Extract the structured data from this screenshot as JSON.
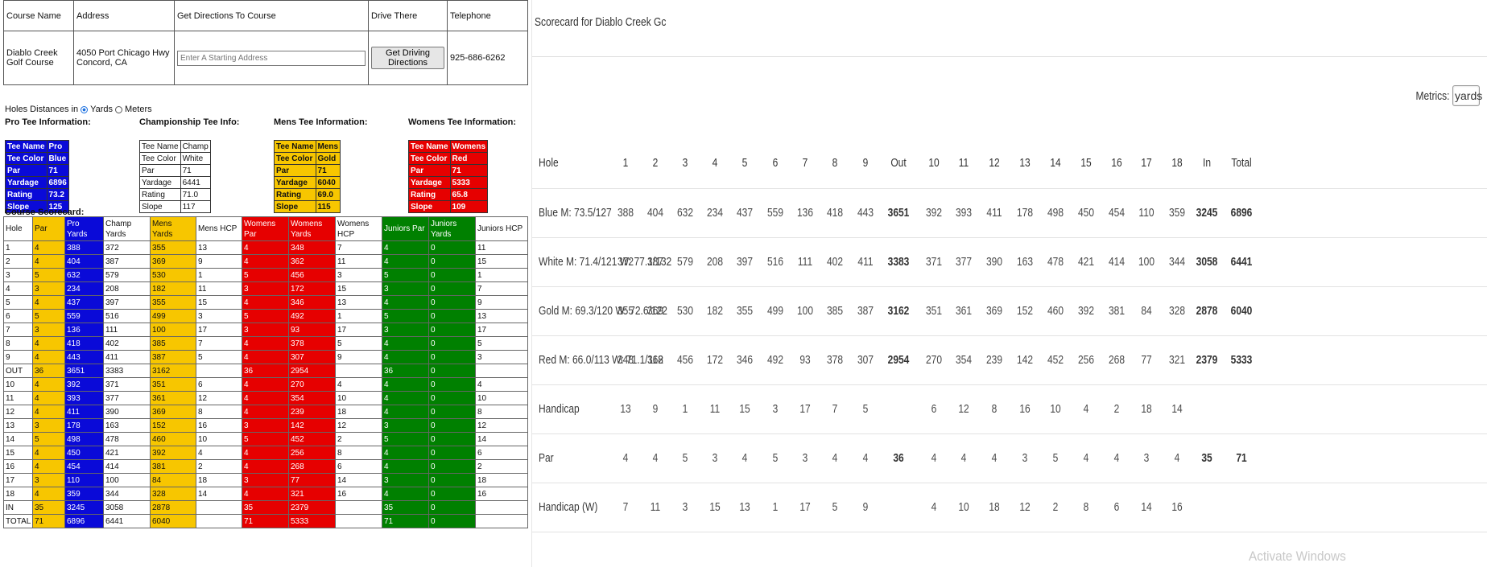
{
  "course_info": {
    "headers": [
      "Course Name",
      "Address",
      "Get Directions To Course",
      "Drive There",
      "Telephone"
    ],
    "course_name": "Diablo Creek Golf Course",
    "address_line1": "4050 Port Chicago Hwy",
    "address_line2": "Concord, CA",
    "directions_placeholder": "Enter A Starting Address",
    "directions_button": "Get Driving Directions",
    "telephone": "925-686-6262"
  },
  "units": {
    "label": "Holes Distances in",
    "yards": "Yards",
    "meters": "Meters",
    "selected": "yards"
  },
  "tee_headings": {
    "pro": "Pro Tee Information:",
    "champ": "Championship Tee Info:",
    "mens": "Mens Tee Information:",
    "womens": "Womens Tee Information:"
  },
  "tees": {
    "pro": [
      [
        "Tee Name",
        "Pro"
      ],
      [
        "Tee Color",
        "Blue"
      ],
      [
        "Par",
        "71"
      ],
      [
        "Yardage",
        "6896"
      ],
      [
        "Rating",
        "73.2"
      ],
      [
        "Slope",
        "125"
      ]
    ],
    "champ": [
      [
        "Tee Name",
        "Champ"
      ],
      [
        "Tee Color",
        "White"
      ],
      [
        "Par",
        "71"
      ],
      [
        "Yardage",
        "6441"
      ],
      [
        "Rating",
        "71.0"
      ],
      [
        "Slope",
        "117"
      ]
    ],
    "mens": [
      [
        "Tee Name",
        "Mens"
      ],
      [
        "Tee Color",
        "Gold"
      ],
      [
        "Par",
        "71"
      ],
      [
        "Yardage",
        "6040"
      ],
      [
        "Rating",
        "69.0"
      ],
      [
        "Slope",
        "115"
      ]
    ],
    "womens": [
      [
        "Tee Name",
        "Womens"
      ],
      [
        "Tee Color",
        "Red"
      ],
      [
        "Par",
        "71"
      ],
      [
        "Yardage",
        "5333"
      ],
      [
        "Rating",
        "65.8"
      ],
      [
        "Slope",
        "109"
      ]
    ]
  },
  "scorecard_title": "Course Scorecard:",
  "scorecard": {
    "headers": [
      "Hole",
      "Par",
      "Pro Yards",
      "Champ Yards",
      "Mens Yards",
      "Mens HCP",
      "Womens Par",
      "Womens Yards",
      "Womens HCP",
      "Juniors Par",
      "Juniors Yards",
      "Juniors HCP"
    ],
    "rows": [
      [
        "1",
        "4",
        "388",
        "372",
        "355",
        "13",
        "4",
        "348",
        "7",
        "4",
        "0",
        "11"
      ],
      [
        "2",
        "4",
        "404",
        "387",
        "369",
        "9",
        "4",
        "362",
        "11",
        "4",
        "0",
        "15"
      ],
      [
        "3",
        "5",
        "632",
        "579",
        "530",
        "1",
        "5",
        "456",
        "3",
        "5",
        "0",
        "1"
      ],
      [
        "4",
        "3",
        "234",
        "208",
        "182",
        "11",
        "3",
        "172",
        "15",
        "3",
        "0",
        "7"
      ],
      [
        "5",
        "4",
        "437",
        "397",
        "355",
        "15",
        "4",
        "346",
        "13",
        "4",
        "0",
        "9"
      ],
      [
        "6",
        "5",
        "559",
        "516",
        "499",
        "3",
        "5",
        "492",
        "1",
        "5",
        "0",
        "13"
      ],
      [
        "7",
        "3",
        "136",
        "111",
        "100",
        "17",
        "3",
        "93",
        "17",
        "3",
        "0",
        "17"
      ],
      [
        "8",
        "4",
        "418",
        "402",
        "385",
        "7",
        "4",
        "378",
        "5",
        "4",
        "0",
        "5"
      ],
      [
        "9",
        "4",
        "443",
        "411",
        "387",
        "5",
        "4",
        "307",
        "9",
        "4",
        "0",
        "3"
      ],
      [
        "OUT",
        "36",
        "3651",
        "3383",
        "3162",
        "",
        "36",
        "2954",
        "",
        "36",
        "0",
        ""
      ],
      [
        "10",
        "4",
        "392",
        "371",
        "351",
        "6",
        "4",
        "270",
        "4",
        "4",
        "0",
        "4"
      ],
      [
        "11",
        "4",
        "393",
        "377",
        "361",
        "12",
        "4",
        "354",
        "10",
        "4",
        "0",
        "10"
      ],
      [
        "12",
        "4",
        "411",
        "390",
        "369",
        "8",
        "4",
        "239",
        "18",
        "4",
        "0",
        "8"
      ],
      [
        "13",
        "3",
        "178",
        "163",
        "152",
        "16",
        "3",
        "142",
        "12",
        "3",
        "0",
        "12"
      ],
      [
        "14",
        "5",
        "498",
        "478",
        "460",
        "10",
        "5",
        "452",
        "2",
        "5",
        "0",
        "14"
      ],
      [
        "15",
        "4",
        "450",
        "421",
        "392",
        "4",
        "4",
        "256",
        "8",
        "4",
        "0",
        "6"
      ],
      [
        "16",
        "4",
        "454",
        "414",
        "381",
        "2",
        "4",
        "268",
        "6",
        "4",
        "0",
        "2"
      ],
      [
        "17",
        "3",
        "110",
        "100",
        "84",
        "18",
        "3",
        "77",
        "14",
        "3",
        "0",
        "18"
      ],
      [
        "18",
        "4",
        "359",
        "344",
        "328",
        "14",
        "4",
        "321",
        "16",
        "4",
        "0",
        "16"
      ],
      [
        "IN",
        "35",
        "3245",
        "3058",
        "2878",
        "",
        "35",
        "2379",
        "",
        "35",
        "0",
        ""
      ],
      [
        "TOTAL",
        "71",
        "6896",
        "6441",
        "6040",
        "",
        "71",
        "5333",
        "",
        "71",
        "0",
        ""
      ]
    ]
  },
  "right": {
    "title": "Scorecard for Diablo Creek Gc",
    "metrics_label": "Metrics:",
    "metrics_value": "yards",
    "columns": [
      "Hole",
      "1",
      "2",
      "3",
      "4",
      "5",
      "6",
      "7",
      "8",
      "9",
      "Out",
      "10",
      "11",
      "12",
      "13",
      "14",
      "15",
      "16",
      "17",
      "18",
      "In",
      "Total"
    ],
    "rows": [
      [
        "Blue M: 73.5/127",
        "388",
        "404",
        "632",
        "234",
        "437",
        "559",
        "136",
        "418",
        "443",
        "3651",
        "392",
        "393",
        "411",
        "178",
        "498",
        "450",
        "454",
        "110",
        "359",
        "3245",
        "6896"
      ],
      [
        "White M: 71.4/121 W: 77.1/132",
        "372",
        "387",
        "579",
        "208",
        "397",
        "516",
        "111",
        "402",
        "411",
        "3383",
        "371",
        "377",
        "390",
        "163",
        "478",
        "421",
        "414",
        "100",
        "344",
        "3058",
        "6441"
      ],
      [
        "Gold M: 69.3/120 W: 72.6/122",
        "355",
        "369",
        "530",
        "182",
        "355",
        "499",
        "100",
        "385",
        "387",
        "3162",
        "351",
        "361",
        "369",
        "152",
        "460",
        "392",
        "381",
        "84",
        "328",
        "2878",
        "6040"
      ],
      [
        "Red M: 66.0/113 W: 71.1/118",
        "348",
        "362",
        "456",
        "172",
        "346",
        "492",
        "93",
        "378",
        "307",
        "2954",
        "270",
        "354",
        "239",
        "142",
        "452",
        "256",
        "268",
        "77",
        "321",
        "2379",
        "5333"
      ],
      [
        "Handicap",
        "13",
        "9",
        "1",
        "11",
        "15",
        "3",
        "17",
        "7",
        "5",
        "",
        "6",
        "12",
        "8",
        "16",
        "10",
        "4",
        "2",
        "18",
        "14",
        "",
        ""
      ],
      [
        "Par",
        "4",
        "4",
        "5",
        "3",
        "4",
        "5",
        "3",
        "4",
        "4",
        "36",
        "4",
        "4",
        "4",
        "3",
        "5",
        "4",
        "4",
        "3",
        "4",
        "35",
        "71"
      ],
      [
        "Handicap (W)",
        "7",
        "11",
        "3",
        "15",
        "13",
        "1",
        "17",
        "5",
        "9",
        "",
        "4",
        "10",
        "18",
        "12",
        "2",
        "8",
        "6",
        "14",
        "16",
        "",
        ""
      ]
    ]
  },
  "watermark": "Activate Windows"
}
